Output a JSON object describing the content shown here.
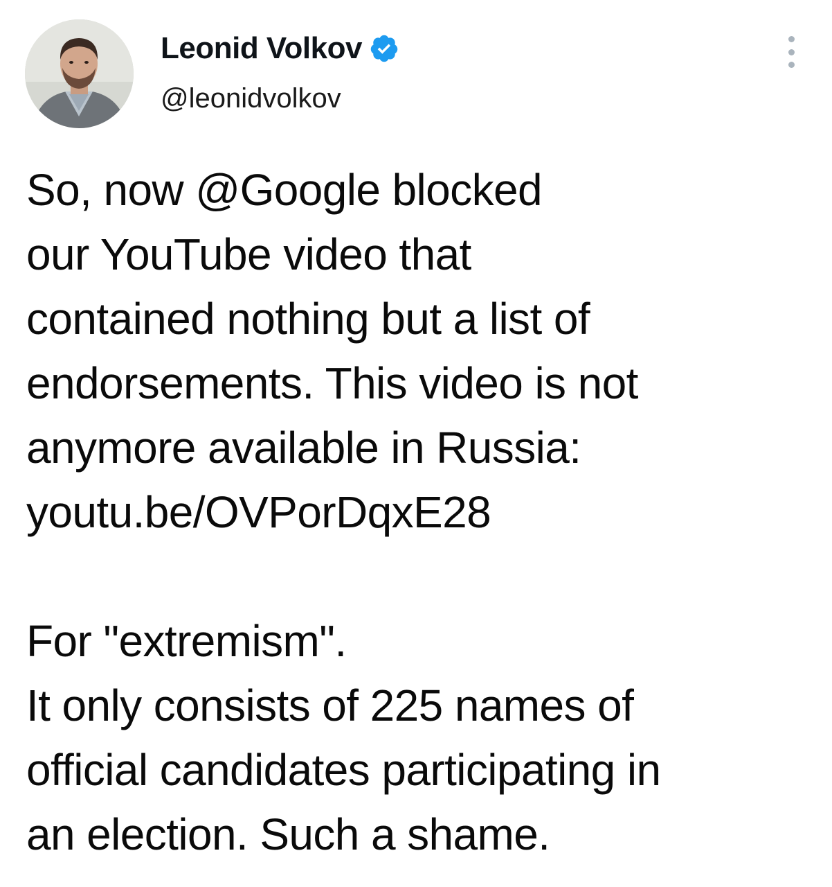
{
  "author": {
    "display_name": "Leonid Volkov",
    "handle": "@leonidvolkov",
    "verified": true,
    "avatar_icon": "person-avatar-icon",
    "verified_icon": "verified-badge-icon"
  },
  "menu": {
    "icon": "more-vertical-icon"
  },
  "tweet": {
    "lines": [
      "So, now @Google blocked",
      "our YouTube video that",
      "contained nothing but a list of",
      "endorsements. This video is not",
      "anymore available in Russia:",
      "youtu.be/OVPorDqxE28",
      "",
      "For \"extremism\".",
      "It only consists of 225 names of",
      "official candidates participating in",
      "an election. Such a shame."
    ]
  },
  "colors": {
    "text": "#0f1419",
    "verified_badge": "#1d9bf0",
    "menu_dots": "#aab4bd"
  }
}
